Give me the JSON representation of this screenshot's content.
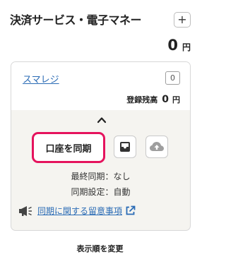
{
  "section": {
    "title": "決済サービス・電子マネー",
    "add_label": "+",
    "total_amount": "0",
    "total_unit": "円"
  },
  "account": {
    "name": "スマレジ",
    "count_badge": "0",
    "balance_label": "登録残高",
    "balance_amount": "0",
    "balance_unit": "円",
    "sync_button_label": "口座を同期",
    "last_sync": "最終同期：なし",
    "sync_setting": "同期設定：自動",
    "notice_link": "同期に関する留意事項"
  },
  "icons": {
    "add": "plus-icon",
    "collapse": "chevron-up-icon",
    "inbox": "inbox-icon",
    "upload": "cloud-upload-icon",
    "notice": "megaphone-icon",
    "external": "external-link-icon"
  },
  "colors": {
    "highlight": "#e5135d",
    "link": "#2a6bb5",
    "card_bg": "#f5f4f0"
  },
  "footer": {
    "sort_label": "表示順を変更"
  }
}
